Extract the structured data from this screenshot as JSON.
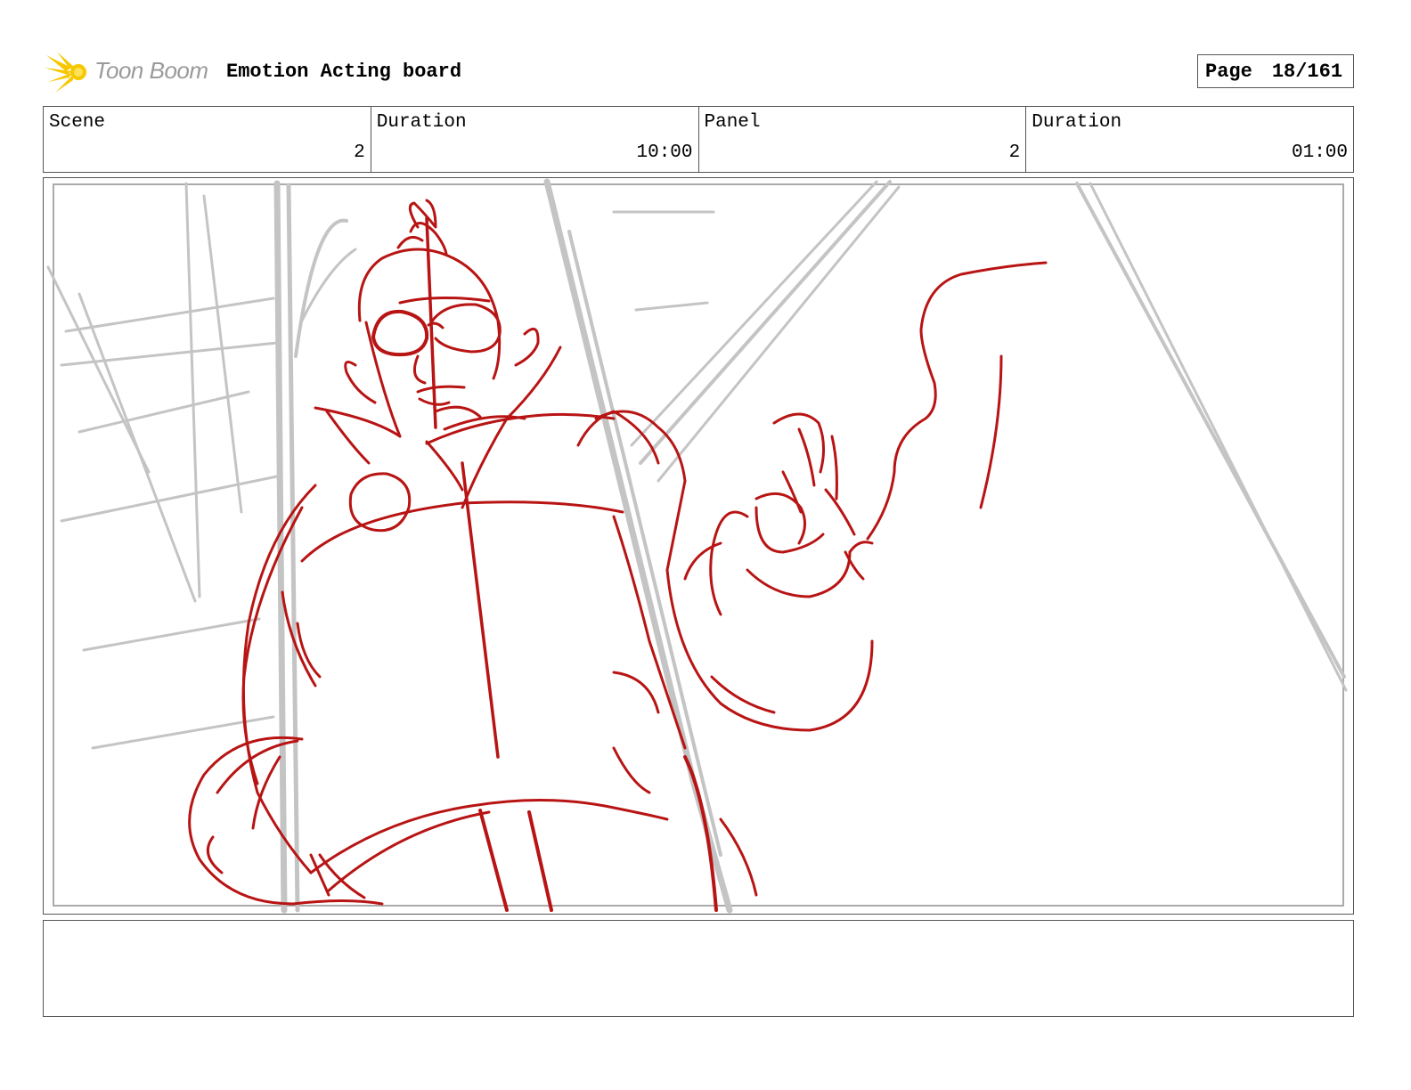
{
  "header": {
    "logo_text": "Toon Boom",
    "board_title": "Emotion Acting board",
    "page_label": "Page",
    "page_value": "18/161"
  },
  "info": {
    "scene_label": "Scene",
    "scene_value": "2",
    "scene_duration_label": "Duration",
    "scene_duration_value": "10:00",
    "panel_label": "Panel",
    "panel_value": "2",
    "panel_duration_label": "Duration",
    "panel_duration_value": "01:00"
  },
  "notes": {
    "text": ""
  },
  "colors": {
    "sketch_red": "#b81414",
    "sketch_gray": "#c4c4c4",
    "logo_yellow": "#f7c800"
  }
}
